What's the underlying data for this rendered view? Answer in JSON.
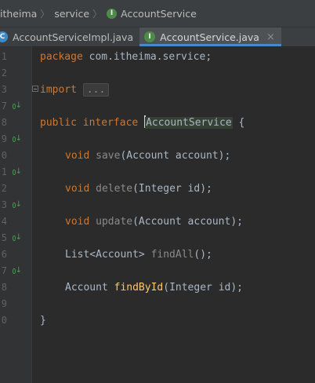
{
  "breadcrumb": {
    "items": [
      "itheima",
      "service",
      "AccountService"
    ],
    "interface_icon": "I"
  },
  "tabs": [
    {
      "label": "AccountServiceImpl.java",
      "icon": "C",
      "icon_name": "class-icon",
      "active": false
    },
    {
      "label": "AccountService.java",
      "icon": "I",
      "icon_name": "interface-icon",
      "active": true
    }
  ],
  "tab_close_glyph": "×",
  "editor": {
    "lines": [
      {
        "num": "1",
        "mark": false
      },
      {
        "num": "2",
        "mark": false
      },
      {
        "num": "3",
        "mark": false
      },
      {
        "num": "7",
        "mark": true
      },
      {
        "num": "8",
        "mark": false
      },
      {
        "num": "9",
        "mark": true
      },
      {
        "num": "0",
        "mark": false
      },
      {
        "num": "1",
        "mark": true
      },
      {
        "num": "2",
        "mark": false
      },
      {
        "num": "3",
        "mark": true
      },
      {
        "num": "4",
        "mark": false
      },
      {
        "num": "5",
        "mark": true
      },
      {
        "num": "6",
        "mark": false
      },
      {
        "num": "7",
        "mark": true
      },
      {
        "num": "8",
        "mark": false
      },
      {
        "num": "9",
        "mark": false
      },
      {
        "num": "0",
        "mark": false
      }
    ],
    "code": {
      "package_kw": "package",
      "package_name": " com.itheima.service;",
      "import_kw": "import",
      "import_fold": "...",
      "public_kw": "public",
      "interface_kw": "interface",
      "interface_name": "AccountService",
      "open_brace": " {",
      "m1_ret": "void",
      "m1_name": "save",
      "m1_params": "(Account account);",
      "m2_ret": "void",
      "m2_name": "delete",
      "m2_params": "(Integer id);",
      "m3_ret": "void",
      "m3_name": "update",
      "m3_params": "(Account account);",
      "m4_ret": "List<Account>",
      "m4_name": "findAll",
      "m4_params": "();",
      "m5_ret": "Account",
      "m5_name": "findById",
      "m5_params": "(Integer id);",
      "close_brace": "}"
    }
  },
  "colors": {
    "keyword": "#cc7832",
    "method_used": "#ffc66d",
    "method_unused": "#8a8a8a",
    "text": "#a9b7c6",
    "gutter_mark": "#499c54",
    "tab_underline": "#4a88c7"
  }
}
